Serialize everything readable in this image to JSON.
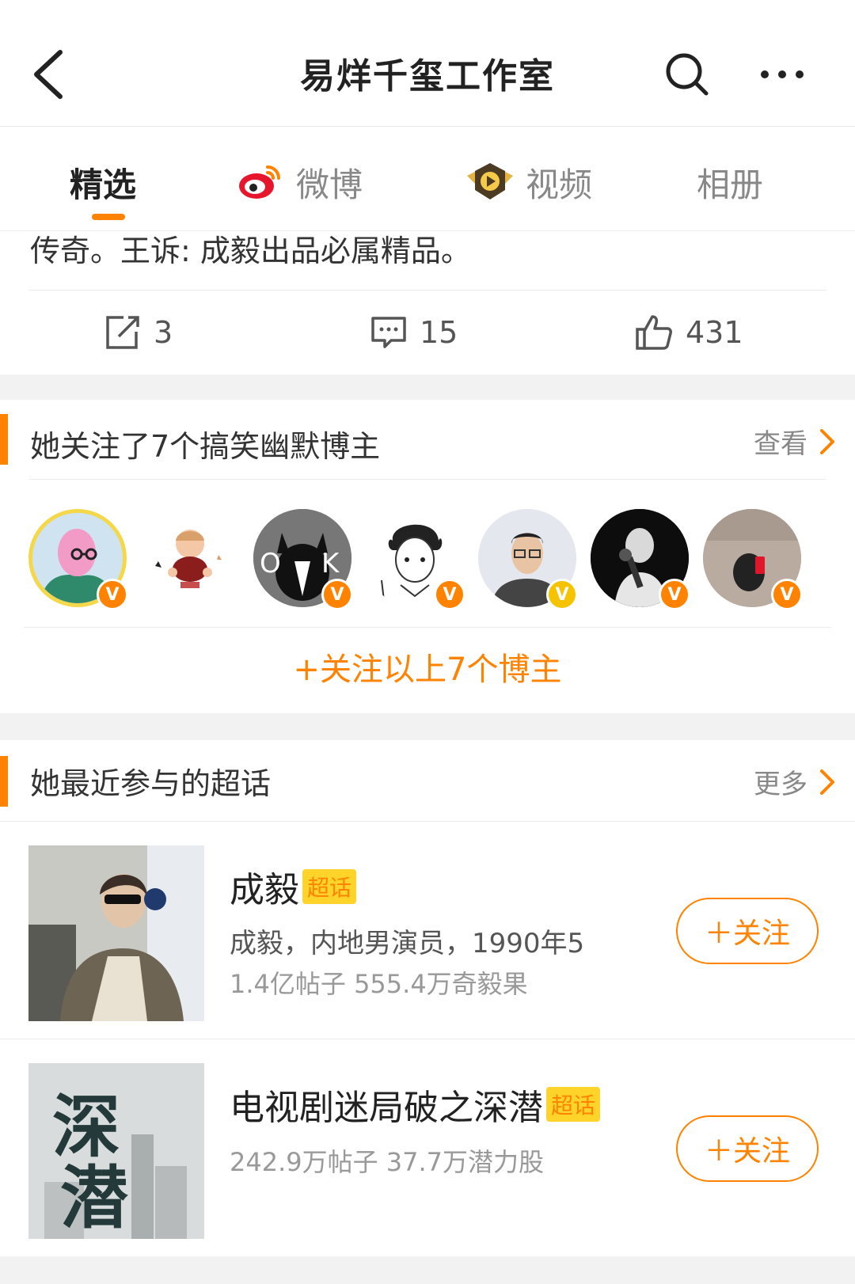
{
  "header": {
    "title": "易烊千玺工作室"
  },
  "tabs": [
    {
      "label": "精选",
      "active": true
    },
    {
      "label": "微博",
      "active": false,
      "icon": "weibo-logo-icon"
    },
    {
      "label": "视频",
      "active": false,
      "icon": "video-badge-icon"
    },
    {
      "label": "相册",
      "active": false
    }
  ],
  "post": {
    "text_tail": "传奇。王诉: 成毅出品必属精品。",
    "reposts": "3",
    "comments": "15",
    "likes": "431"
  },
  "followed": {
    "title": "她关注了7个搞笑幽默博主",
    "more_label": "查看",
    "avatars": [
      {
        "name": "cartoon-pink-head",
        "badge": "orange"
      },
      {
        "name": "cartoon-baby",
        "badge": "none"
      },
      {
        "name": "cat-ok",
        "badge": "orange",
        "text_left": "O",
        "text_right": "K"
      },
      {
        "name": "sketch-boy",
        "badge": "orange"
      },
      {
        "name": "man-glasses",
        "badge": "gold"
      },
      {
        "name": "man-microphone",
        "badge": "orange"
      },
      {
        "name": "woman-phone",
        "badge": "orange"
      }
    ],
    "follow_all_label": "+关注以上7个博主"
  },
  "topics": {
    "title": "她最近参与的超话",
    "more_label": "更多",
    "items": [
      {
        "name": "成毅",
        "tag": "超话",
        "desc": "成毅，内地男演员，1990年5",
        "stats": "1.4亿帖子 555.4万奇毅果",
        "follow_label": "＋关注"
      },
      {
        "name": "电视剧迷局破之深潜",
        "tag": "超话",
        "stats": "242.9万帖子 37.7万潜力股",
        "thumb_text": "深潜",
        "follow_label": "＋关注"
      }
    ]
  },
  "colors": {
    "accent": "#ff8200",
    "badge_gold": "#f5c300",
    "tag_bg": "#ffd42a"
  }
}
